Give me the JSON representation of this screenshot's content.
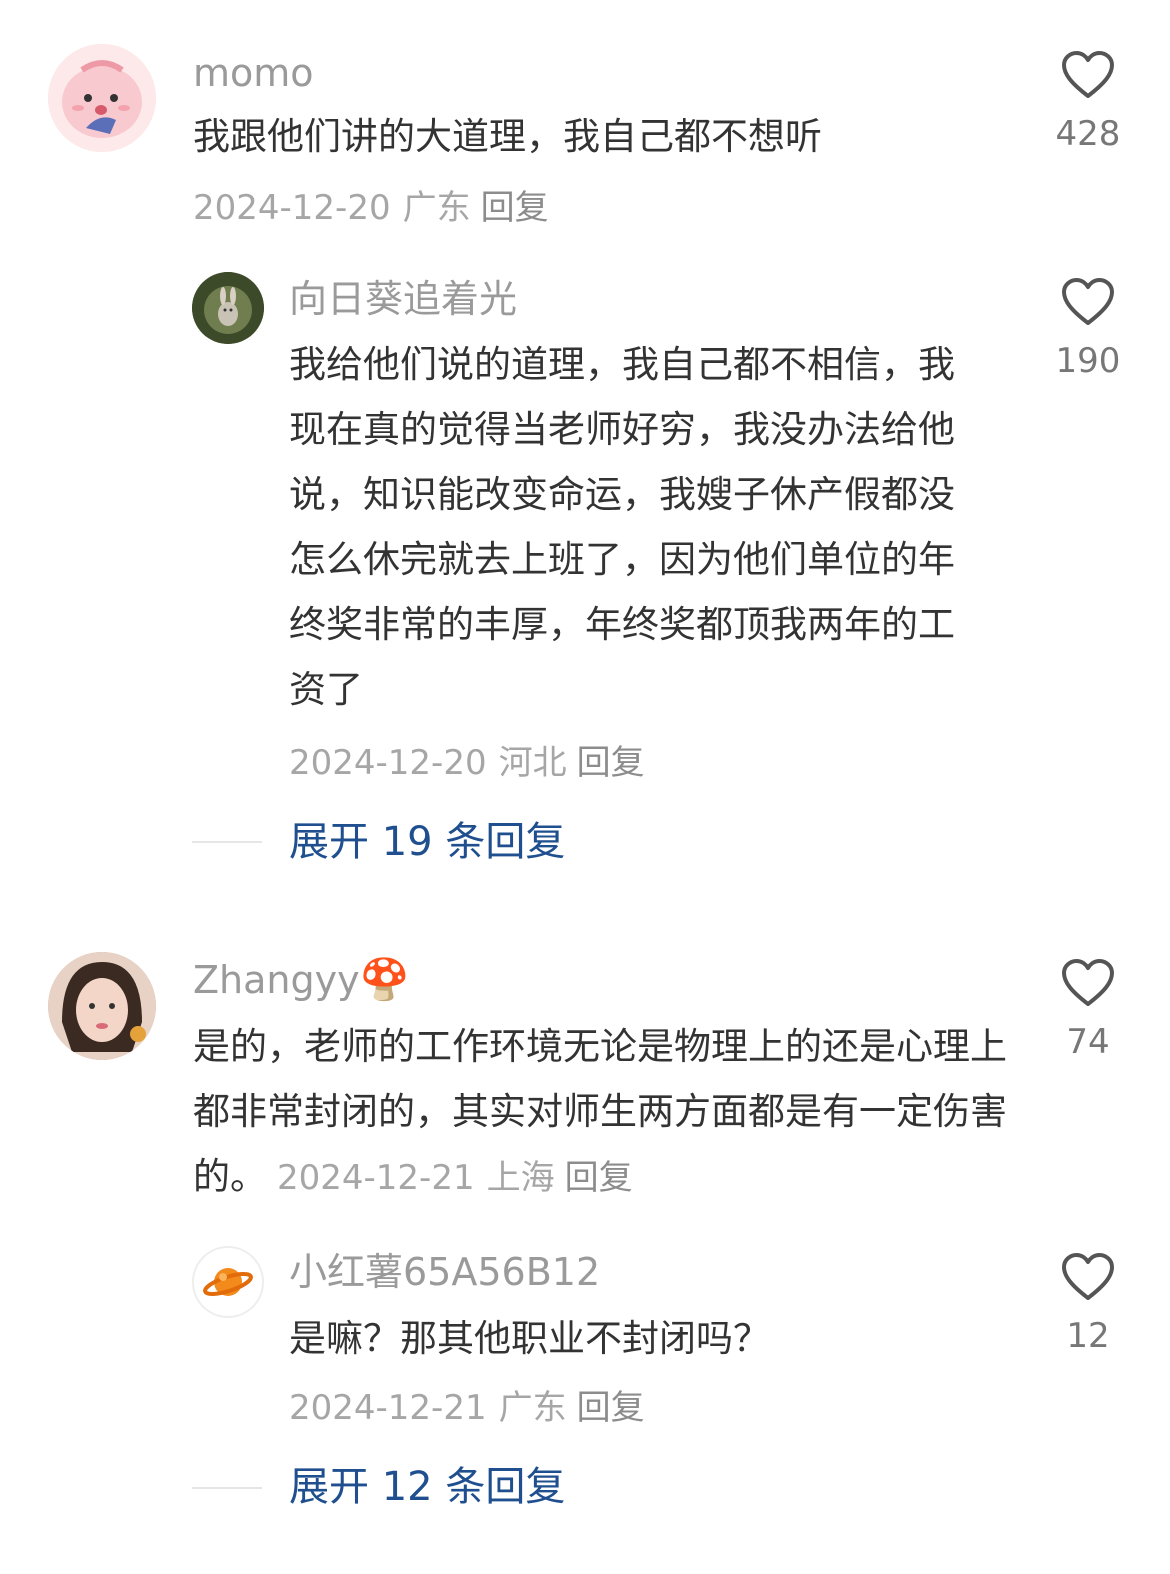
{
  "comments": [
    {
      "username": "momo",
      "text": "我跟他们讲的大道理，我自己都不想听",
      "date": "2024-12-20",
      "location": "广东",
      "reply_label": "回复",
      "likes": "428",
      "avatar_icon": "pink-cartoon-avatar",
      "replies": [
        {
          "username": "向日葵追着光",
          "text": "我给他们说的道理，我自己都不相信，我现在真的觉得当老师好穷，我没办法给他说，知识能改变命运，我嫂子休产假都没怎么休完就去上班了，因为他们单位的年终奖非常的丰厚，年终奖都顶我两年的工资了",
          "date": "2024-12-20",
          "location": "河北",
          "reply_label": "回复",
          "likes": "190",
          "avatar_icon": "green-rabbit-avatar"
        }
      ],
      "expand_label": "展开 19 条回复"
    },
    {
      "username": "Zhangyy",
      "username_emoji": "🍄",
      "text": "是的，老师的工作环境无论是物理上的还是心理上都非常封闭的，其实对师生两方面都是有一定伤害的。",
      "date": "2024-12-21",
      "location": "上海",
      "reply_label": "回复",
      "likes": "74",
      "avatar_icon": "girl-photo-avatar",
      "replies": [
        {
          "username": "小红薯65A56B12",
          "text": "是嘛？那其他职业不封闭吗？",
          "date": "2024-12-21",
          "location": "广东",
          "reply_label": "回复",
          "likes": "12",
          "avatar_icon": "planet-avatar"
        }
      ],
      "expand_label": "展开 12 条回复"
    }
  ],
  "colors": {
    "username": "#9a9a9a",
    "text": "#333333",
    "meta": "#a6a6a6",
    "expand": "#1f4f8f",
    "heart_stroke": "#555555"
  }
}
